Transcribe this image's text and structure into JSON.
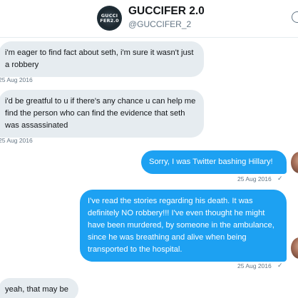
{
  "header": {
    "avatar_line1": "GUCCI",
    "avatar_line2": "FER2.0",
    "display_name": "GUCCIFER 2.0",
    "screen_name": "@GUCCIFER_2"
  },
  "messages": [
    {
      "direction": "incoming",
      "text": "i'm eager to find fact about seth, i'm sure it wasn't just a robbery",
      "timestamp": "25 Aug 2016"
    },
    {
      "direction": "incoming",
      "text": "i'd be greatful to u if there's any chance u can help me find the person who can find the evidence that seth was assassinated",
      "timestamp": "25 Aug 2016"
    },
    {
      "direction": "outgoing",
      "text": "Sorry, I was Twitter bashing Hillary!",
      "timestamp": "25 Aug 2016",
      "status": "✓"
    },
    {
      "direction": "outgoing",
      "text": "I've read the stories regarding his death. It was definitely NO robbery!!! I've even thought he might have been murdered, by someone in the ambulance, since he was breathing and alive when being transported to the hospital.",
      "timestamp": "25 Aug 2016",
      "status": "✓"
    },
    {
      "direction": "incoming",
      "text": "yeah, that may be",
      "timestamp": ""
    }
  ],
  "colors": {
    "outgoing_bubble": "#1da1f2",
    "incoming_bubble": "#e6ecf0",
    "timestamp": "#657786"
  },
  "icons": {
    "info": "info-icon",
    "read_receipt": "checkmark-icon"
  }
}
